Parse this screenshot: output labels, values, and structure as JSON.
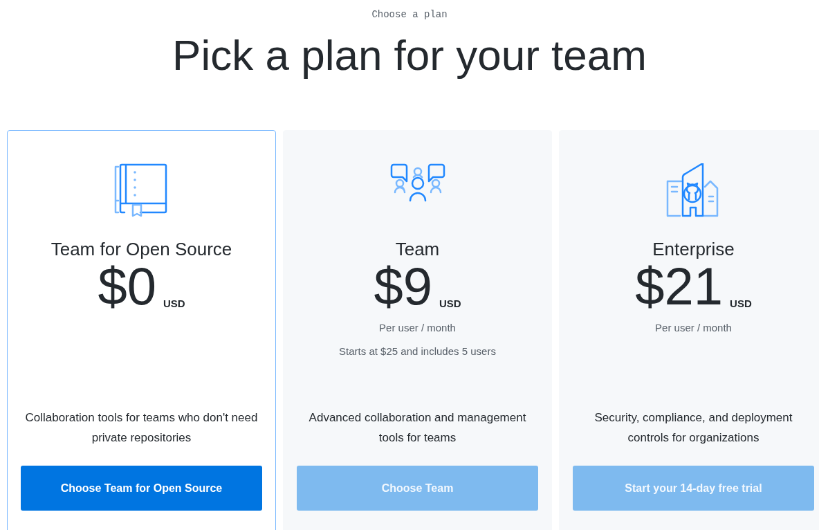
{
  "eyebrow": "Choose a plan",
  "title": "Pick a plan for your team",
  "plans": [
    {
      "kind": "book",
      "name": "Team for Open Source",
      "price": "$0",
      "currency": "USD",
      "description": "Collaboration tools for teams who don't need private repositories",
      "button": "Choose Team for Open Source",
      "selected": true
    },
    {
      "kind": "people",
      "name": "Team",
      "price": "$9",
      "currency": "USD",
      "notes": [
        "Per user / month",
        "Starts at $25 and includes 5 users"
      ],
      "description": "Advanced collaboration and management tools for teams",
      "button": "Choose Team",
      "selected": false
    },
    {
      "kind": "building",
      "name": "Enterprise",
      "price": "$21",
      "currency": "USD",
      "notes": [
        "Per user / month"
      ],
      "description": "Security, compliance, and deployment controls for organizations",
      "button": "Start your 14-day free trial",
      "selected": false
    }
  ]
}
